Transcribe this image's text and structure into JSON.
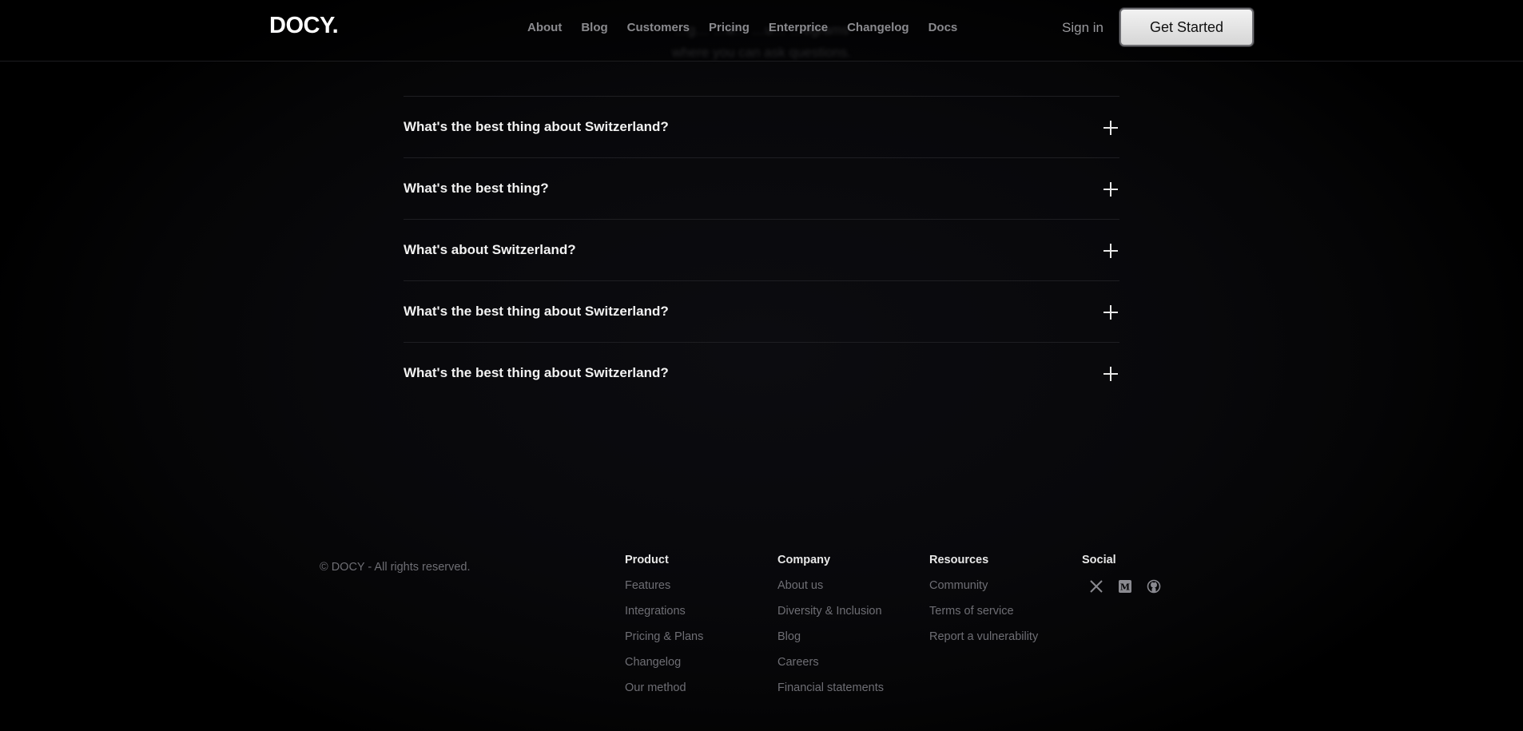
{
  "ghost_subtitle": "…g…  …a…  …u…  …ograms\nwhere you can ask questions.",
  "brand": {
    "logo_text": "DOCY."
  },
  "nav": {
    "items": [
      "About",
      "Blog",
      "Customers",
      "Pricing",
      "Enterprice",
      "Changelog",
      "Docs"
    ]
  },
  "header": {
    "signin_label": "Sign in",
    "cta_label": "Get Started"
  },
  "faq": {
    "items": [
      "What's the best thing about Switzerland?",
      "What's the best thing?",
      "What's about Switzerland?",
      "What's the best thing about Switzerland?",
      "What's the best thing about Switzerland?"
    ]
  },
  "footer": {
    "copyright": "© DOCY - All rights reserved.",
    "product": {
      "heading": "Product",
      "links": [
        "Features",
        "Integrations",
        "Pricing & Plans",
        "Changelog",
        "Our method"
      ]
    },
    "company": {
      "heading": "Company",
      "links": [
        "About us",
        "Diversity & Inclusion",
        "Blog",
        "Careers",
        "Financial statements"
      ]
    },
    "resources": {
      "heading": "Resources",
      "links": [
        "Community",
        "Terms of service",
        "Report a vulnerability"
      ]
    },
    "social": {
      "heading": "Social",
      "icons": [
        "x-twitter-icon",
        "medium-icon",
        "github-icon"
      ]
    }
  },
  "colors": {
    "background": "#000000",
    "text_primary": "#ffffff",
    "text_muted": "#6e6e74",
    "nav_text": "#8a8a8e",
    "cta_bg": "#e6e6e6",
    "divider": "#1e1e22"
  }
}
